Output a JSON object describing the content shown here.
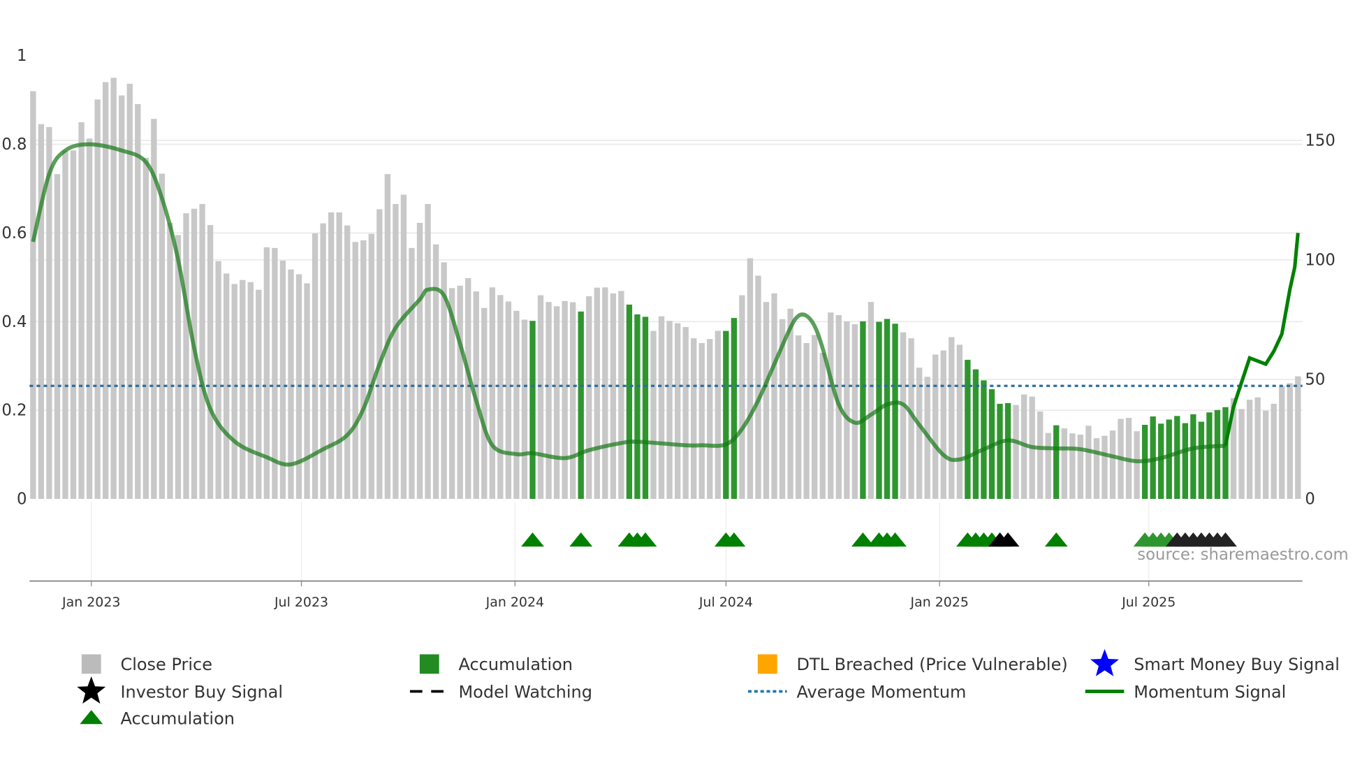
{
  "chart_data": {
    "type": "bar",
    "title": "",
    "x_tick_labels": [
      "Jan 2023",
      "Jul 2023",
      "Jan 2024",
      "Jul 2024",
      "Jan 2025",
      "Jul 2025"
    ],
    "left_axis": {
      "ticks": [
        "0",
        "0.2",
        "0.4",
        "0.6",
        "0.8",
        "1"
      ],
      "values": [
        0,
        0.2,
        0.4,
        0.6,
        0.8,
        1
      ],
      "ylim": [
        0,
        1
      ]
    },
    "right_axis": {
      "ticks": [
        "0",
        "50",
        "100",
        "150"
      ],
      "values": [
        0,
        50,
        100,
        150
      ],
      "ylim": [
        0,
        185.5
      ]
    },
    "close_price": [
      170.6,
      156.8,
      155.6,
      135.9,
      145.8,
      145.8,
      157.6,
      150.8,
      167.1,
      174.4,
      176.2,
      168.8,
      173.7,
      165.2,
      142.7,
      159.0,
      136.1,
      115.5,
      110.4,
      119.5,
      121.4,
      123.4,
      114.6,
      99.5,
      94.3,
      89.9,
      91.6,
      90.7,
      87.5,
      105.3,
      105.0,
      99.7,
      96.0,
      94.0,
      90.2,
      111.1,
      115.3,
      119.9,
      119.9,
      114.4,
      107.5,
      108.2,
      110.9,
      121.2,
      135.9,
      123.4,
      127.3,
      105.0,
      115.5,
      123.4,
      106.5,
      99.0,
      88.2,
      89.2,
      92.4,
      86.8,
      79.9,
      88.5,
      85.3,
      82.6,
      78.7,
      75.0,
      74.5,
      85.2,
      82.4,
      80.6,
      82.8,
      82.3,
      78.4,
      84.8,
      88.4,
      88.5,
      86.0,
      87.0,
      81.3,
      77.2,
      76.2,
      70.3,
      76.4,
      74.5,
      73.5,
      71.9,
      67.2,
      65.2,
      66.9,
      70.3,
      70.3,
      75.7,
      85.2,
      100.7,
      93.4,
      82.4,
      86.0,
      75.2,
      79.6,
      68.4,
      65.2,
      68.6,
      61.1,
      78.0,
      76.9,
      74.3,
      73.1,
      74.3,
      82.4,
      74.1,
      75.3,
      73.3,
      69.7,
      67.2,
      54.9,
      51.1,
      60.4,
      62.1,
      67.7,
      64.5,
      58.2,
      54.2,
      49.6,
      45.9,
      39.8,
      40.1,
      39.3,
      43.7,
      42.8,
      36.6,
      27.6,
      30.8,
      29.5,
      27.4,
      26.9,
      30.6,
      25.4,
      26.4,
      28.6,
      33.5,
      33.9,
      28.3,
      31.0,
      34.5,
      31.5,
      33.2,
      34.7,
      31.7,
      35.4,
      32.3,
      36.2,
      37.2,
      38.4,
      42.2,
      37.6,
      41.5,
      42.5,
      36.9,
      39.8,
      47.2,
      48.4,
      51.3
    ],
    "accumulation_bars": [
      62,
      68,
      74,
      75,
      76,
      86,
      87,
      103,
      105,
      106,
      107,
      116,
      117,
      118,
      119,
      120,
      121,
      127,
      138,
      139,
      140,
      141,
      142,
      143,
      144,
      145,
      146,
      147,
      148
    ],
    "accumulation_markers": [
      {
        "bar": 62,
        "color": "#008000"
      },
      {
        "bar": 68,
        "color": "#008000"
      },
      {
        "bar": 74,
        "color": "#008000"
      },
      {
        "bar": 75,
        "color": "#008000"
      },
      {
        "bar": 76,
        "color": "#008000"
      },
      {
        "bar": 86,
        "color": "#008000"
      },
      {
        "bar": 87,
        "color": "#008000"
      },
      {
        "bar": 103,
        "color": "#008000"
      },
      {
        "bar": 105,
        "color": "#008000"
      },
      {
        "bar": 106,
        "color": "#008000"
      },
      {
        "bar": 107,
        "color": "#008000"
      },
      {
        "bar": 116,
        "color": "#008000"
      },
      {
        "bar": 117,
        "color": "#008000"
      },
      {
        "bar": 118,
        "color": "#008000"
      },
      {
        "bar": 119,
        "color": "#008000"
      },
      {
        "bar": 120,
        "color": "#000000"
      },
      {
        "bar": 121,
        "color": "#000000"
      },
      {
        "bar": 127,
        "color": "#008000"
      },
      {
        "bar": 138,
        "color": "#2f962f"
      },
      {
        "bar": 139,
        "color": "#2f962f"
      },
      {
        "bar": 140,
        "color": "#2f962f"
      },
      {
        "bar": 141,
        "color": "#2f962f"
      },
      {
        "bar": 142,
        "color": "#222222"
      },
      {
        "bar": 143,
        "color": "#222222"
      },
      {
        "bar": 144,
        "color": "#222222"
      },
      {
        "bar": 145,
        "color": "#222222"
      },
      {
        "bar": 146,
        "color": "#222222"
      },
      {
        "bar": 147,
        "color": "#222222"
      },
      {
        "bar": 148,
        "color": "#222222"
      }
    ],
    "momentum_signal": [
      [
        0,
        0.58
      ],
      [
        2,
        0.733
      ],
      [
        4,
        0.786
      ],
      [
        7,
        0.8
      ],
      [
        11,
        0.786
      ],
      [
        14,
        0.76
      ],
      [
        16,
        0.678
      ],
      [
        18,
        0.54
      ],
      [
        20,
        0.34
      ],
      [
        22,
        0.203
      ],
      [
        25,
        0.13
      ],
      [
        29,
        0.094
      ],
      [
        32,
        0.078
      ],
      [
        36,
        0.112
      ],
      [
        39,
        0.144
      ],
      [
        41,
        0.203
      ],
      [
        43,
        0.304
      ],
      [
        45,
        0.386
      ],
      [
        48,
        0.45
      ],
      [
        49,
        0.472
      ],
      [
        51,
        0.459
      ],
      [
        53,
        0.35
      ],
      [
        55,
        0.222
      ],
      [
        57,
        0.121
      ],
      [
        60,
        0.101
      ],
      [
        62,
        0.103
      ],
      [
        66,
        0.092
      ],
      [
        69,
        0.11
      ],
      [
        73,
        0.126
      ],
      [
        75,
        0.129
      ],
      [
        81,
        0.121
      ],
      [
        83,
        0.121
      ],
      [
        86,
        0.123
      ],
      [
        88,
        0.158
      ],
      [
        90,
        0.222
      ],
      [
        92,
        0.304
      ],
      [
        94,
        0.386
      ],
      [
        95,
        0.413
      ],
      [
        96,
        0.413
      ],
      [
        97,
        0.39
      ],
      [
        98,
        0.34
      ],
      [
        100,
        0.213
      ],
      [
        102,
        0.172
      ],
      [
        104,
        0.19
      ],
      [
        106,
        0.213
      ],
      [
        108,
        0.213
      ],
      [
        110,
        0.167
      ],
      [
        113,
        0.099
      ],
      [
        115,
        0.089
      ],
      [
        118,
        0.112
      ],
      [
        121,
        0.132
      ],
      [
        124,
        0.117
      ],
      [
        127,
        0.114
      ],
      [
        130,
        0.112
      ],
      [
        134,
        0.096
      ],
      [
        137,
        0.085
      ],
      [
        140,
        0.092
      ],
      [
        144,
        0.114
      ],
      [
        148,
        0.12
      ],
      [
        149,
        0.208
      ],
      [
        151,
        0.318
      ],
      [
        153,
        0.304
      ],
      [
        154,
        0.333
      ],
      [
        155,
        0.372
      ],
      [
        156,
        0.473
      ],
      [
        156.6,
        0.523
      ],
      [
        157,
        0.6
      ]
    ],
    "average_momentum": 0.255,
    "source": "source: sharemaestro.com",
    "legend": [
      {
        "label": "Close Price",
        "symbol": "square",
        "color": "#bbbbbb"
      },
      {
        "label": "Accumulation",
        "symbol": "square",
        "color": "#228b22"
      },
      {
        "label": "DTL Breached (Price Vulnerable)",
        "symbol": "square",
        "color": "#ffa500"
      },
      {
        "label": "Smart Money Buy Signal",
        "symbol": "star",
        "color": "#0000ff"
      },
      {
        "label": "Investor Buy Signal",
        "symbol": "star",
        "color": "#000000"
      },
      {
        "label": "Model Watching",
        "symbol": "dash",
        "color": "#000000"
      },
      {
        "label": "Average Momentum",
        "symbol": "dot",
        "color": "#1f77b4"
      },
      {
        "label": "Momentum Signal",
        "symbol": "line",
        "color": "#008000"
      },
      {
        "label": "Accumulation",
        "symbol": "triangle",
        "color": "#008000"
      }
    ]
  }
}
